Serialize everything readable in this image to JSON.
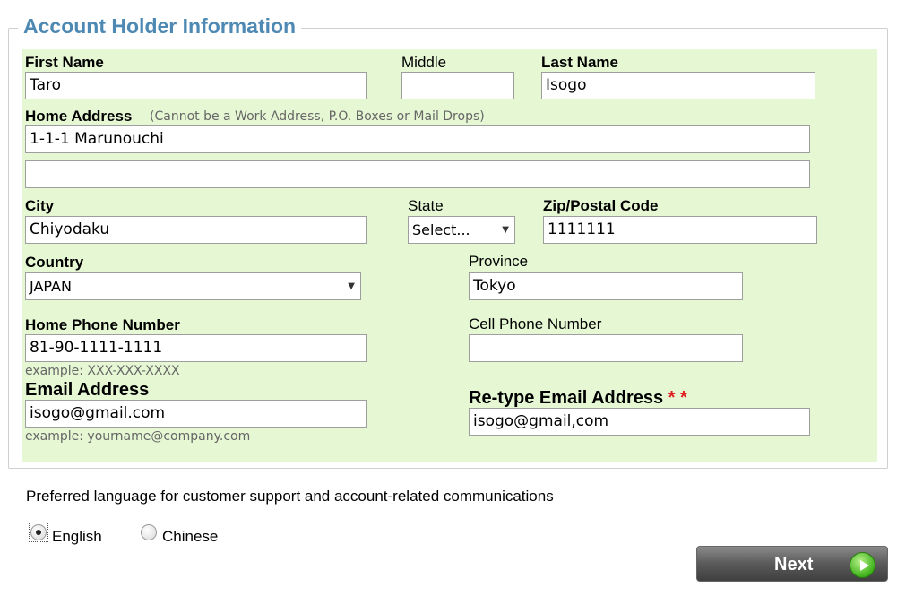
{
  "section_title": "Account Holder Information",
  "labels": {
    "first_name": "First Name",
    "middle": "Middle",
    "last_name": "Last Name",
    "home_address": "Home Address",
    "home_address_note": "(Cannot be a Work Address, P.O. Boxes or Mail Drops)",
    "city": "City",
    "state": "State",
    "zip": "Zip/Postal Code",
    "country": "Country",
    "province": "Province",
    "home_phone": "Home Phone Number",
    "cell_phone": "Cell Phone Number",
    "email": "Email Address",
    "retype_email": "Re-type Email Address",
    "retype_email_required": "* *"
  },
  "values": {
    "first_name": "Taro",
    "middle": "",
    "last_name": "Isogo",
    "address_line1": "1-1-1 Marunouchi",
    "address_line2": "",
    "city": "Chiyodaku",
    "state": "Select...",
    "zip": "1111111",
    "country": "JAPAN",
    "province": "Tokyo",
    "home_phone": "81-90-1111-1111",
    "cell_phone": "",
    "email": "isogo@gmail.com",
    "retype_email": "isogo@gmail,com"
  },
  "hints": {
    "phone_example": "example: XXX-XXX-XXXX",
    "email_example": "example: yourname@company.com"
  },
  "language": {
    "prompt": "Preferred language for customer support and account-related communications",
    "options": [
      "English",
      "Chinese"
    ],
    "selected": "English"
  },
  "next_button": {
    "label": "Next",
    "icon": "play-arrow-icon"
  },
  "colors": {
    "panel_bg": "#e6f7d4",
    "title": "#4e89b4",
    "required": "#e02020"
  }
}
